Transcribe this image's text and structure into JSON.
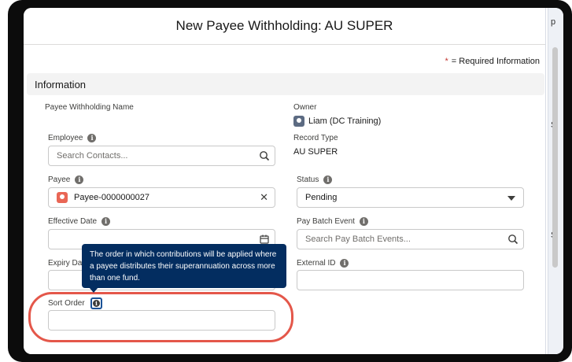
{
  "modal": {
    "title": "New Payee Withholding: AU SUPER",
    "required_note": "= Required Information",
    "section_title": "Information"
  },
  "background": {
    "text_1": "p",
    "text_2": "S",
    "text_3": "S"
  },
  "fields": {
    "payee_withholding_name": {
      "label": "Payee Withholding Name"
    },
    "owner": {
      "label": "Owner",
      "value": "Liam (DC Training)"
    },
    "employee": {
      "label": "Employee",
      "placeholder": "Search Contacts..."
    },
    "record_type": {
      "label": "Record Type",
      "value": "AU SUPER"
    },
    "payee": {
      "label": "Payee",
      "value": "Payee-0000000027"
    },
    "status": {
      "label": "Status",
      "value": "Pending"
    },
    "effective_date": {
      "label": "Effective Date",
      "value": ""
    },
    "pay_batch_event": {
      "label": "Pay Batch Event",
      "placeholder": "Search Pay Batch Events..."
    },
    "expiry_date": {
      "label": "Expiry Da",
      "value": ""
    },
    "external_id": {
      "label": "External ID",
      "value": ""
    },
    "sort_order": {
      "label": "Sort Order",
      "value": ""
    }
  },
  "tooltip": {
    "text": "The order in which contributions will be applied where a payee distributes their superannuation across more than one fund."
  },
  "colors": {
    "tooltip_bg": "#032d60",
    "highlight_ring": "#e4574a",
    "required_star": "#c23934",
    "payee_icon": "#e96655"
  }
}
